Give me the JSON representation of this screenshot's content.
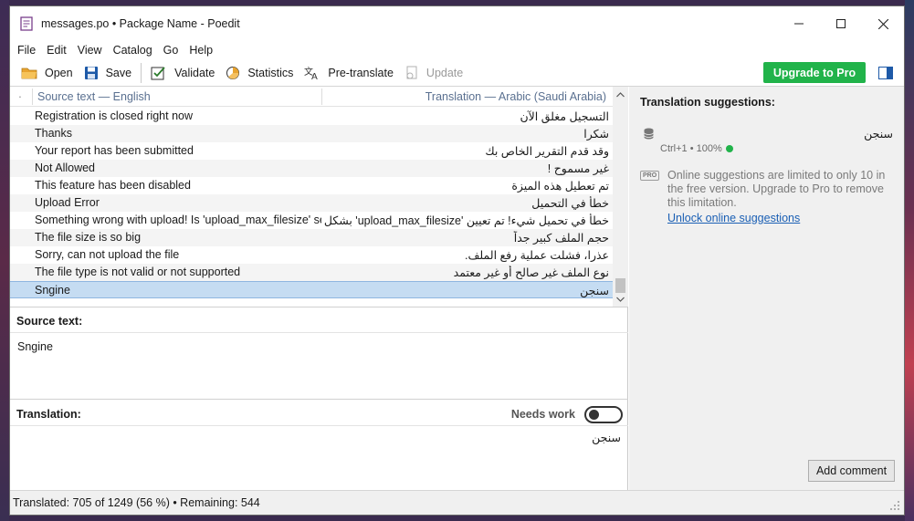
{
  "window": {
    "title": "messages.po • Package Name - Poedit"
  },
  "menu": [
    "File",
    "Edit",
    "View",
    "Catalog",
    "Go",
    "Help"
  ],
  "toolbar": {
    "open": "Open",
    "save": "Save",
    "validate": "Validate",
    "statistics": "Statistics",
    "pretranslate": "Pre-translate",
    "update": "Update",
    "upgrade": "Upgrade to Pro"
  },
  "list": {
    "header_bullet": "·",
    "header_source": "Source text — English",
    "header_translation": "Translation — Arabic (Saudi Arabia)",
    "rows": [
      {
        "source": "Registration is closed right now",
        "translation": "التسجيل مغلق الآن"
      },
      {
        "source": "Thanks",
        "translation": "شكرا"
      },
      {
        "source": "Your report has been submitted",
        "translation": "وقد قدم التقرير الخاص بك"
      },
      {
        "source": "Not Allowed",
        "translation": "غير مسموح !"
      },
      {
        "source": "This feature has been disabled",
        "translation": "تم تعطيل هذه الميزة"
      },
      {
        "source": "Upload Error",
        "translation": "خطأ في التحميل"
      },
      {
        "source": "Something wrong with upload! Is 'upload_max_filesize' se...",
        "translation": "خطأ في تحميل شيء! تم تعيين 'upload_max_filesize' بشكل ..."
      },
      {
        "source": "The file size is so big",
        "translation": "حجم الملف كبير جداً"
      },
      {
        "source": "Sorry, can not upload the file",
        "translation": "عذرا، فشلت عملية رفع الملف."
      },
      {
        "source": "The file type is not valid or not supported",
        "translation": "نوع الملف غير صالح أو غير معتمد"
      },
      {
        "source": "Sngine",
        "translation": "سنجن",
        "selected": true
      }
    ]
  },
  "source_panel": {
    "label": "Source text:",
    "text": "Sngine"
  },
  "translation_panel": {
    "label": "Translation:",
    "needs_work": "Needs work",
    "text": "سنجن"
  },
  "suggestions": {
    "title": "Translation suggestions:",
    "item_text": "سنجن",
    "item_meta": "Ctrl+1 • 100%",
    "pro_badge": "PRO",
    "pro_notice": "Online suggestions are limited to only 10 in the free version. Upgrade to Pro to remove this limitation.",
    "unlock_link": "Unlock online suggestions",
    "add_comment": "Add comment"
  },
  "status": {
    "text": "Translated: 705 of 1249 (56 %)  •  Remaining: 544"
  },
  "colors": {
    "upgrade": "#21b34a",
    "selection": "#c5dcf2",
    "link": "#1a5fb4"
  }
}
